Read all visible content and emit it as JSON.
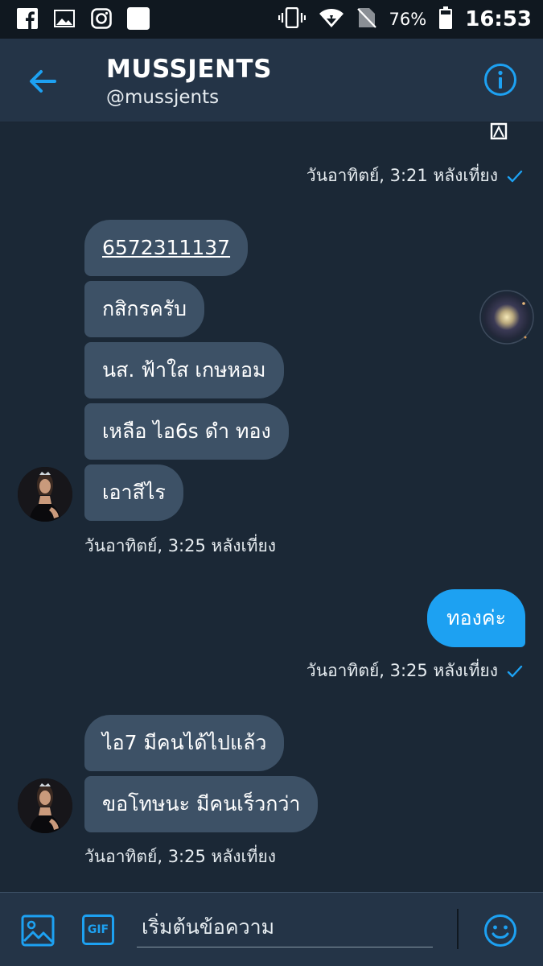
{
  "status_bar": {
    "battery_percent": "76%",
    "time": "16:53",
    "icons": [
      "facebook-icon",
      "gallery-icon",
      "instagram-icon",
      "app-icon",
      "vibrate-icon",
      "wifi-icon",
      "no-sim-icon",
      "battery-icon"
    ]
  },
  "header": {
    "title": "MUSSJENTS",
    "handle": "@mussjents"
  },
  "messages": {
    "ts1": "วันอาทิตย์, 3:21 หลังเที่ยง",
    "incoming_group1": [
      "6572311137",
      "กสิกรครับ",
      "นส. ฟ้าใส เกษหอม",
      "เหลือ ไอ6s ดำ ทอง",
      "เอาสีไร"
    ],
    "ts2": "วันอาทิตย์, 3:25 หลังเที่ยง",
    "outgoing1": "ทองค่ะ",
    "ts3": "วันอาทิตย์, 3:25 หลังเที่ยง",
    "incoming_group2": [
      "ไอ7 มีคนได้ไปแล้ว",
      "ขอโทษนะ มีคนเร็วกว่า"
    ],
    "ts4": "วันอาทิตย์, 3:25 หลังเที่ยง"
  },
  "composer": {
    "placeholder": "เริ่มต้นข้อความ",
    "gif_label": "GIF"
  },
  "colors": {
    "background": "#1b2836",
    "header": "#243447",
    "incoming_bubble": "#3d5166",
    "outgoing_bubble": "#1da1f2",
    "accent": "#1da1f2"
  }
}
